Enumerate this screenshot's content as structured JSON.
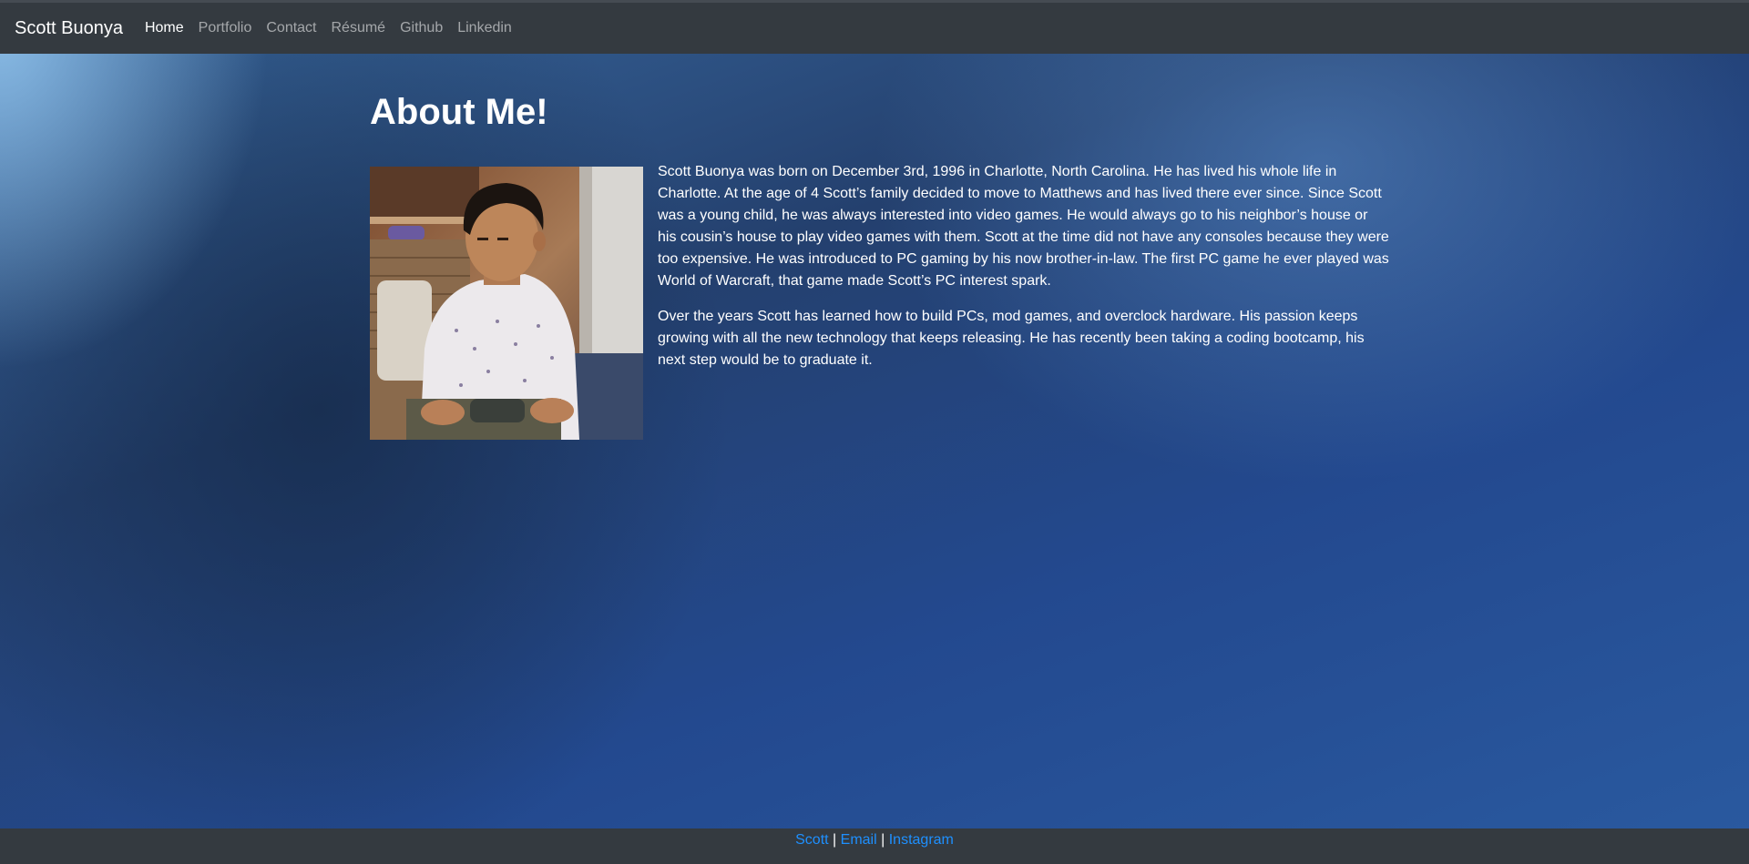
{
  "navbar": {
    "brand": "Scott Buonya",
    "items": [
      {
        "label": "Home",
        "active": true
      },
      {
        "label": "Portfolio",
        "active": false
      },
      {
        "label": "Contact",
        "active": false
      },
      {
        "label": "Résumé",
        "active": false
      },
      {
        "label": "Github",
        "active": false
      },
      {
        "label": "Linkedin",
        "active": false
      }
    ]
  },
  "main": {
    "title": "About Me!",
    "photo_icon": "profile-photo",
    "paragraphs": [
      "Scott Buonya was born on December 3rd, 1996 in Charlotte, North Carolina. He has lived his whole life in Charlotte. At the age of 4 Scott’s family decided to move to Matthews and has lived there ever since. Since Scott was a young child, he was always interested into video games. He would always go to his neighbor’s house or his cousin’s house to play video games with them. Scott at the time did not have any consoles because they were too expensive. He was introduced to PC gaming by his now brother-in-law. The first PC game he ever played was World of Warcraft, that game made Scott’s PC interest spark.",
      "Over the years Scott has learned how to build PCs, mod games, and overclock hardware. His passion keeps growing with all the new technology that keeps releasing. He has recently been taking a coding bootcamp, his next step would be to graduate it."
    ]
  },
  "footer": {
    "links": [
      "Scott",
      "Email",
      "Instagram"
    ],
    "separator": "|"
  },
  "colors": {
    "navbar_bg": "#343a40",
    "link_blue": "#1e90ff"
  }
}
